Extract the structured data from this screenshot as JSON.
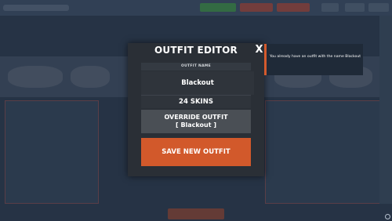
{
  "modal": {
    "title": "OUTFIT EDITOR",
    "close_label": "X",
    "field_label": "OUTFIT NAME",
    "outfit_name_value": "Blackout",
    "skins_count": "24 SKINS",
    "override_line1": "OVERRIDE OUTFIT",
    "override_line2": "[ Blackout ]",
    "save_label": "SAVE NEW OUTFIT"
  },
  "notification": {
    "message": "You already have an outfit with the name Blackout"
  },
  "colors": {
    "accent": "#d2592b",
    "modal_bg": "#2a2f36",
    "override_bg": "#4a4f55"
  },
  "icons": {
    "corner": "circle-icon"
  }
}
